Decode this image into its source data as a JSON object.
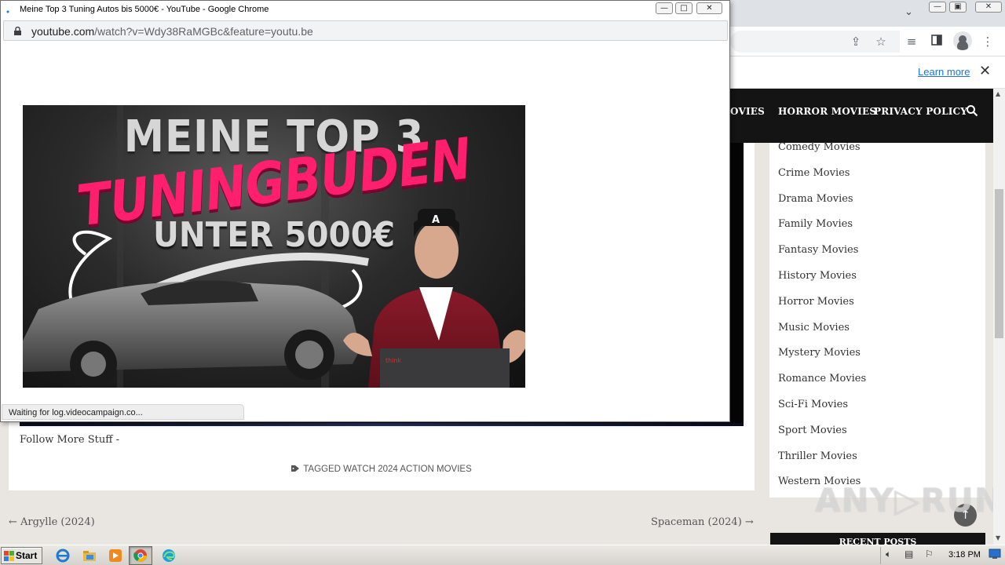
{
  "popup": {
    "title": "Meine Top 3 Tuning Autos bis 5000€ - YouTube - Google Chrome",
    "url_host": "youtube.com",
    "url_path": "/watch?v=Wdy38RaMGBc&feature=youtu.be",
    "status": "Waiting for log.videocampaign.co...",
    "thumbnail": {
      "line1": "MEINE TOP 3",
      "line2": "TUNINGBUDEN",
      "line3": "UNTER 5000€"
    },
    "buttons": {
      "minimize": "—",
      "maximize": "□",
      "close": "✕"
    }
  },
  "background_browser": {
    "tab_dropdown": "⌄",
    "infobar": {
      "learn_more": "Learn more",
      "close": "✕"
    },
    "toolbar_icons": [
      "share-icon",
      "bookmark-star-icon",
      "media-queue-icon",
      "side-panel-icon",
      "profile-icon",
      "menu-icon"
    ]
  },
  "site": {
    "nav": {
      "partial_item": "OVIES",
      "horror": "HORROR MOVIES",
      "privacy": "PRIVACY POLICY"
    },
    "article": {
      "follow": "Follow More Stuff -",
      "tags": "TAGGED WATCH 2024 ACTION MOVIES"
    },
    "post_nav": {
      "prev": "← Argylle (2024)",
      "next": "Spaceman (2024) →"
    },
    "sidebar_categories": [
      "Comedy Movies",
      "Crime Movies",
      "Drama Movies",
      "Family Movies",
      "Fantasy Movies",
      "History Movies",
      "Horror Movies",
      "Music Movies",
      "Mystery Movies",
      "Romance Movies",
      "Sci-Fi Movies",
      "Sport Movies",
      "Thriller Movies",
      "Western Movies"
    ],
    "recent_posts_title": "RECENT POSTS",
    "scroll_top": "↑"
  },
  "watermark": "ANY▷RUN",
  "taskbar": {
    "start": "Start",
    "clock": "3:18 PM",
    "apps": [
      "internet-explorer-icon",
      "file-explorer-icon",
      "media-player-icon",
      "chrome-icon",
      "edge-icon"
    ]
  },
  "colors": {
    "nav_bg": "#141414",
    "accent_pink": "#ff1f6d",
    "link_blue": "#1a73e8"
  }
}
